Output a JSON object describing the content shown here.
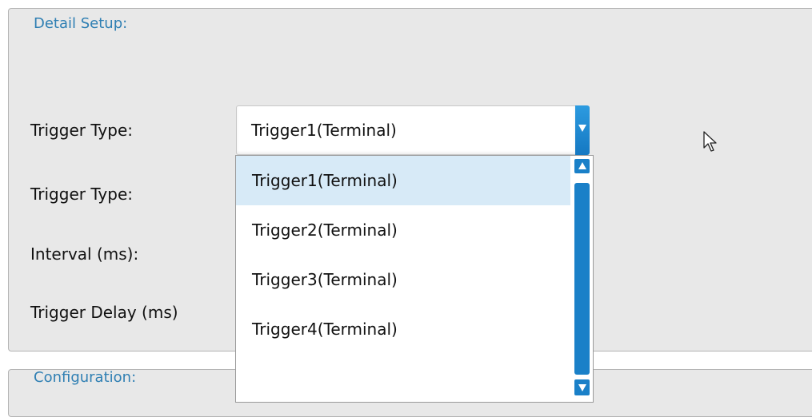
{
  "detail_group": {
    "title": "Detail Setup:"
  },
  "config_group": {
    "title": "Configuration:"
  },
  "labels": {
    "trigger_type_1": "Trigger Type:",
    "trigger_type_2": "Trigger Type:",
    "interval": "Interval (ms):",
    "trigger_delay": "Trigger Delay (ms)"
  },
  "combo": {
    "selected_value": "Trigger1(Terminal)",
    "options": [
      "Trigger1(Terminal)",
      "Trigger2(Terminal)",
      "Trigger3(Terminal)",
      "Trigger4(Terminal)"
    ],
    "highlighted_index": 0
  },
  "icons": {
    "dropdown_arrow": "chevron-down-icon",
    "scroll_up": "scroll-up-arrow-icon",
    "scroll_down": "scroll-down-arrow-icon",
    "cursor": "mouse-pointer-icon"
  },
  "colors": {
    "accent": "#1a80c8",
    "group_title": "#2f7fb3",
    "group_background": "#e8e8e8",
    "highlight": "#d7eaf7"
  }
}
